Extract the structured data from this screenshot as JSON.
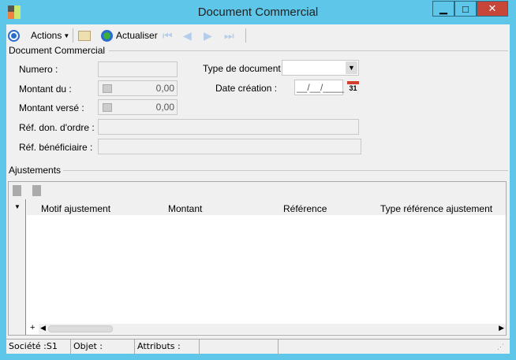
{
  "window": {
    "title": "Document Commercial",
    "minimize": "▁",
    "maximize": "□",
    "close": "✕"
  },
  "toolbar": {
    "actions_label": "Actions",
    "refresh_label": "Actualiser"
  },
  "section_main": "Document Commercial",
  "form": {
    "numero_label": "Numero :",
    "numero_value": "",
    "montant_du_label": "Montant du :",
    "montant_du_value": "0,00",
    "montant_verse_label": "Montant versé :",
    "montant_verse_value": "0,00",
    "ref_don_label": "Réf. don. d'ordre :",
    "ref_don_value": "",
    "ref_benef_label": "Réf. bénéficiaire :",
    "ref_benef_value": "",
    "type_doc_label": "Type de document :",
    "type_doc_value": "",
    "date_label": "Date création :",
    "date_value": "__/__/____",
    "calendar_day": "31"
  },
  "section_adjust": "Ajustements",
  "grid": {
    "columns": [
      "Motif ajustement",
      "Montant",
      "Référence",
      "Type référence ajustement"
    ],
    "add": "+"
  },
  "status": {
    "societe": "Société :S1",
    "objet": "Objet :",
    "attributs": "Attributs :",
    "empty1": "",
    "empty2": ""
  }
}
